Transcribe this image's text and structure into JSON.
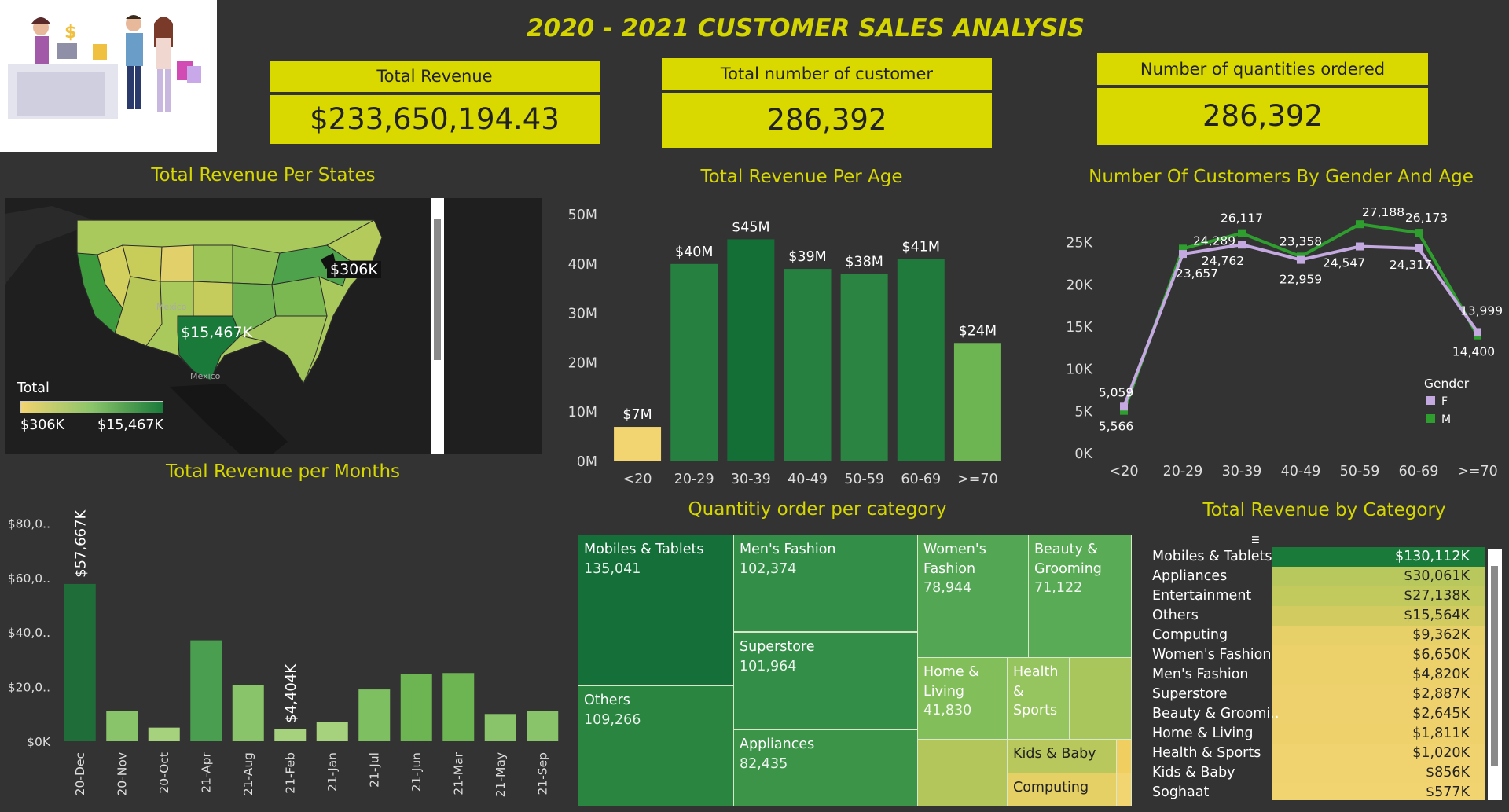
{
  "title": "2020 - 2021 CUSTOMER SALES ANALYSIS",
  "kpis": [
    {
      "label": "Total Revenue",
      "value": "$233,650,194.43"
    },
    {
      "label": "Total number of customer",
      "value": "286,392"
    },
    {
      "label": "Number of quantities ordered",
      "value": "286,392"
    }
  ],
  "map_panel": {
    "title": "Total Revenue Per States",
    "legend_title": "Total",
    "legend_min": "$306K",
    "legend_max": "$15,467K",
    "label_high": "$15,467K",
    "label_low": "$306K",
    "label_country": "Mexico"
  },
  "colors": {
    "accent": "#d9d900",
    "dark_green": "#1a7a3a",
    "mid_green": "#4a9e50",
    "light_green": "#8ac46a",
    "yellow": "#f2d470",
    "female": "#c4a8e0",
    "male": "#2e9e2e"
  },
  "chart_data": [
    {
      "type": "bar",
      "title": "Total Revenue Per Age",
      "categories": [
        "<20",
        "20-29",
        "30-39",
        "40-49",
        "50-59",
        "60-69",
        ">=70"
      ],
      "values": [
        7,
        40,
        45,
        39,
        38,
        41,
        24
      ],
      "data_labels": [
        "$7M",
        "$40M",
        "$45M",
        "$39M",
        "$38M",
        "$41M",
        "$24M"
      ],
      "yticks": [
        "0M",
        "10M",
        "20M",
        "30M",
        "40M",
        "50M"
      ],
      "ylim": [
        0,
        50
      ],
      "grid": false
    },
    {
      "type": "line",
      "title": "Number Of Customers By Gender And Age",
      "categories": [
        "<20",
        "20-29",
        "30-39",
        "40-49",
        "50-59",
        "60-69",
        ">=70"
      ],
      "series": [
        {
          "name": "F",
          "values": [
            5566,
            23657,
            24762,
            22959,
            24547,
            24317,
            14400
          ]
        },
        {
          "name": "M",
          "values": [
            5059,
            24289,
            26117,
            23358,
            27188,
            26173,
            13999
          ]
        }
      ],
      "f_labels": [
        "5,566",
        "23,657",
        "24,762",
        "22,959",
        "24,547",
        "24,317",
        "14,400"
      ],
      "m_labels": [
        "5,059",
        "24,289",
        "26,117",
        "23,358",
        "27,188",
        "26,173",
        "13,999"
      ],
      "yticks": [
        "0K",
        "5K",
        "10K",
        "15K",
        "20K",
        "25K"
      ],
      "ylim": [
        0,
        30000
      ],
      "legend_title": "Gender",
      "legend_placement": "right"
    },
    {
      "type": "bar",
      "title": "Total Revenue per Months",
      "categories": [
        "20-Dec",
        "20-Nov",
        "20-Oct",
        "21-Apr",
        "21-Aug",
        "21-Feb",
        "21-Jan",
        "21-Jul",
        "21-Jun",
        "21-Mar",
        "21-May",
        "21-Sep"
      ],
      "values": [
        57667,
        11000,
        5000,
        37000,
        20500,
        4404,
        7000,
        19000,
        24500,
        25000,
        10000,
        11200
      ],
      "data_labels": [
        "$57,667K",
        "",
        "",
        "",
        "",
        "$4,404K",
        "",
        "",
        "",
        "",
        "",
        ""
      ],
      "yticks": [
        "$0K",
        "$20,0..",
        "$40,0..",
        "$60,0..",
        "$80,0.."
      ],
      "ylim": [
        0,
        83000
      ]
    },
    {
      "type": "table",
      "title": "Total Revenue by Category",
      "categories": [
        "Mobiles & Tablets",
        "Appliances",
        "Entertainment",
        "Others",
        "Computing",
        "Women's Fashion",
        "Men's Fashion",
        "Superstore",
        "Beauty & Groomi..",
        "Home & Living",
        "Health & Sports",
        "Kids & Baby",
        "Soghaat"
      ],
      "values": [
        130112,
        30061,
        27138,
        15564,
        9362,
        6650,
        4820,
        2887,
        2645,
        1811,
        1020,
        856,
        577
      ],
      "labels": [
        "$130,112K",
        "$30,061K",
        "$27,138K",
        "$15,564K",
        "$9,362K",
        "$6,650K",
        "$4,820K",
        "$2,887K",
        "$2,645K",
        "$1,811K",
        "$1,020K",
        "$856K",
        "$577K"
      ]
    }
  ],
  "treemap": {
    "title": "Quantitiy order per category",
    "cells": [
      {
        "name": "Mobiles & Tablets",
        "value": "135,041"
      },
      {
        "name": "Men's Fashion",
        "value": "102,374"
      },
      {
        "name": "Women's Fashion",
        "value": "78,944"
      },
      {
        "name": "Beauty & Grooming",
        "value": "71,122"
      },
      {
        "name": "Superstore",
        "value": "101,964"
      },
      {
        "name": "Others",
        "value": "109,266"
      },
      {
        "name": "Home & Living",
        "value": "41,830"
      },
      {
        "name": "Health & Sports",
        "value": ""
      },
      {
        "name": "Appliances",
        "value": "82,435"
      },
      {
        "name": "Kids & Baby",
        "value": ""
      },
      {
        "name": "Computing",
        "value": ""
      }
    ]
  }
}
